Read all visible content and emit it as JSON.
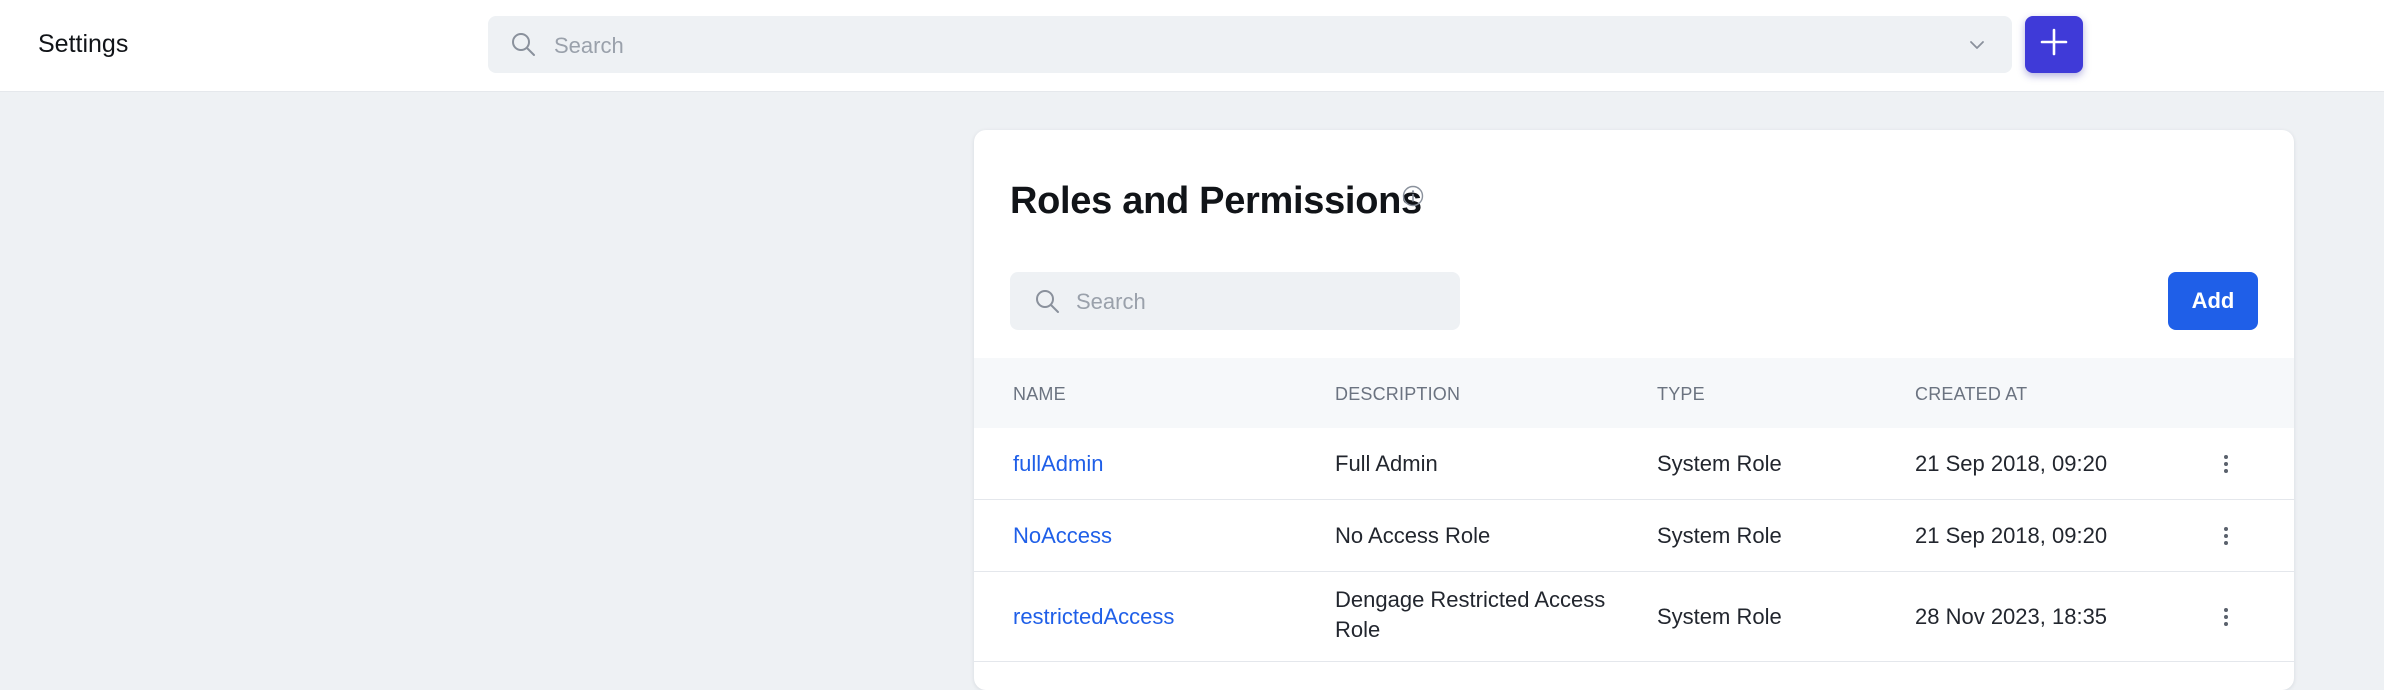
{
  "header": {
    "title": "Settings",
    "search_placeholder": "Search"
  },
  "roles": {
    "title": "Roles and Permissions",
    "search_placeholder": "Search",
    "add_label": "Add",
    "columns": [
      "NAME",
      "DESCRIPTION",
      "TYPE",
      "CREATED AT"
    ],
    "rows": [
      {
        "name": "fullAdmin",
        "description": "Full Admin",
        "type": "System Role",
        "created_at": "21 Sep 2018, 09:20"
      },
      {
        "name": "NoAccess",
        "description": "No Access Role",
        "type": "System Role",
        "created_at": "21 Sep 2018, 09:20"
      },
      {
        "name": "restrictedAccess",
        "description_line1": "Dengage Restricted Access",
        "description_line2": "Role",
        "type": "System Role",
        "created_at": "28 Nov 2023, 18:35"
      }
    ]
  },
  "icons": {
    "search": "search-icon",
    "chevron": "chevron-down-icon",
    "plus": "plus-icon",
    "info": "info-icon",
    "more": "more-vertical-icon"
  },
  "colors": {
    "accent": "#1f5fe8",
    "plus_button": "#3f3ad8",
    "background": "#eef1f4"
  }
}
